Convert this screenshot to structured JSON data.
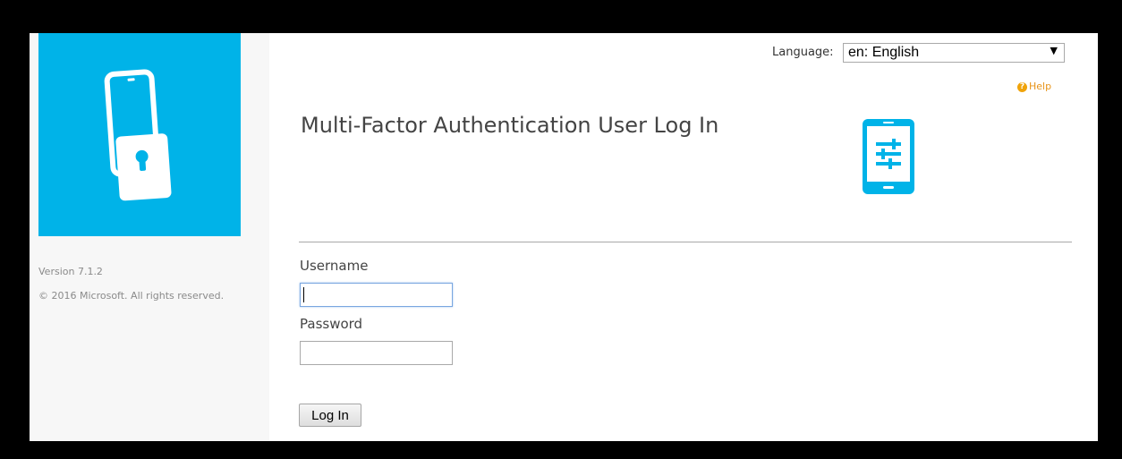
{
  "sidebar": {
    "logo_icon": "phone-lock-icon",
    "version": "Version 7.1.2",
    "copyright": "© 2016 Microsoft. All rights reserved."
  },
  "header": {
    "language_label": "Language:",
    "language_selected": "en: English",
    "help_icon": "question-circle-icon",
    "help_label": "Help"
  },
  "main": {
    "title": "Multi-Factor Authentication User Log In",
    "device_icon": "mobile-settings-icon",
    "username_label": "Username",
    "username_value": "",
    "password_label": "Password",
    "password_value": "",
    "login_label": "Log In"
  },
  "colors": {
    "brand": "#00b3e8",
    "help": "#e8941a",
    "text": "#444444",
    "sidebar_bg": "#f7f7f7",
    "frame_bg": "#000000"
  }
}
